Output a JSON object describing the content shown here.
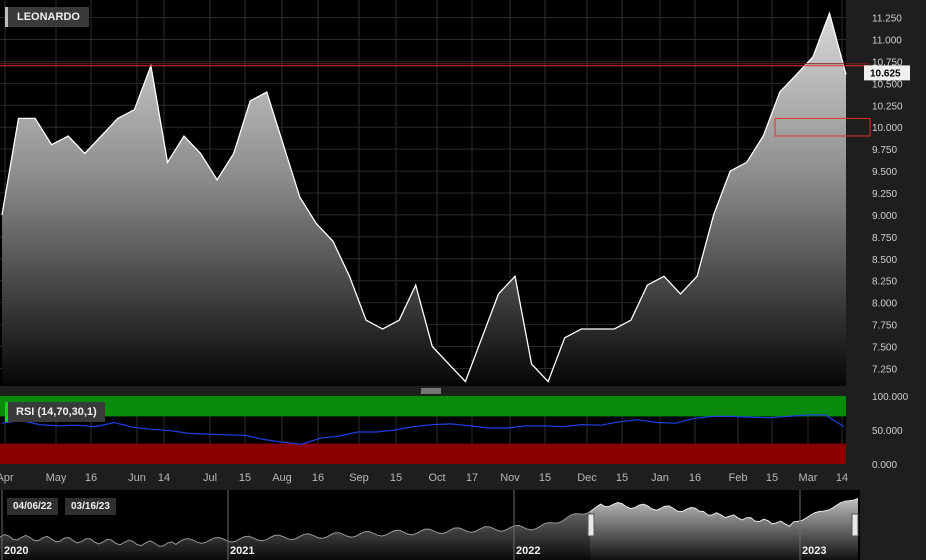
{
  "header": {
    "symbol": "LEONARDO",
    "rsi_label": "RSI (14,70,30,1)"
  },
  "navigator": {
    "range_start": "04/06/22",
    "range_end": "03/16/23",
    "years": [
      "2020",
      "2021",
      "2022",
      "2023"
    ]
  },
  "price_axis": [
    "11.250",
    "11.000",
    "10.750",
    "10.500",
    "10.250",
    "10.000",
    "9.750",
    "9.500",
    "9.250",
    "9.000",
    "8.750",
    "8.500",
    "8.250",
    "8.000",
    "7.750",
    "7.500",
    "7.250"
  ],
  "rsi_axis": [
    "100.000",
    "50.000",
    "0.000"
  ],
  "x_axis": [
    "Apr",
    "May",
    "16",
    "Jun",
    "14",
    "Jul",
    "15",
    "Aug",
    "16",
    "Sep",
    "15",
    "Oct",
    "17",
    "Nov",
    "15",
    "Dec",
    "15",
    "Jan",
    "16",
    "Feb",
    "15",
    "Mar",
    "14"
  ],
  "colors": {
    "line": "#ffffff",
    "rsi_line": "#1f3fe0",
    "overbought": "#0a8a0a",
    "oversold": "#8a0000",
    "marker": "#e03030"
  },
  "chart_data": [
    {
      "type": "area",
      "title": "LEONARDO",
      "ylim": [
        7.05,
        11.45
      ],
      "last_value": "10.625",
      "reference_line": 10.7,
      "x": [
        "Apr",
        "May",
        "16",
        "Jun",
        "14",
        "Jul",
        "15",
        "Aug",
        "16",
        "Sep",
        "15",
        "Oct",
        "17",
        "Nov",
        "15",
        "Dec",
        "15",
        "Jan",
        "16",
        "Feb",
        "15",
        "Mar",
        "14"
      ],
      "series": [
        {
          "values": [
            9.0,
            10.1,
            10.1,
            9.8,
            9.9,
            9.7,
            9.9,
            10.1,
            10.2,
            10.7,
            9.6,
            9.9,
            9.7,
            9.4,
            9.7,
            10.3,
            10.4,
            9.8,
            9.2,
            8.9,
            8.7,
            8.3,
            7.8,
            7.7,
            7.8,
            8.2,
            7.5,
            7.3,
            7.1,
            7.6,
            8.1,
            8.3,
            7.3,
            7.1,
            7.6,
            7.7,
            7.7,
            7.7,
            7.8,
            8.2,
            8.3,
            8.1,
            8.3,
            9.0,
            9.5,
            9.6,
            9.9,
            10.4,
            10.6,
            10.8,
            11.3,
            10.6
          ]
        }
      ]
    },
    {
      "type": "line",
      "title": "RSI (14,70,30,1)",
      "ylim": [
        0,
        100
      ],
      "bands": {
        "overbought": 70,
        "oversold": 30
      },
      "series": [
        {
          "values": [
            60,
            64,
            58,
            56,
            57,
            55,
            61,
            54,
            51,
            49,
            45,
            44,
            43,
            42,
            36,
            32,
            29,
            38,
            41,
            47,
            47,
            50,
            55,
            58,
            59,
            56,
            53,
            53,
            56,
            56,
            55,
            58,
            57,
            62,
            65,
            61,
            60,
            67,
            70,
            70,
            69,
            68,
            70,
            72,
            72,
            55
          ]
        }
      ]
    }
  ]
}
